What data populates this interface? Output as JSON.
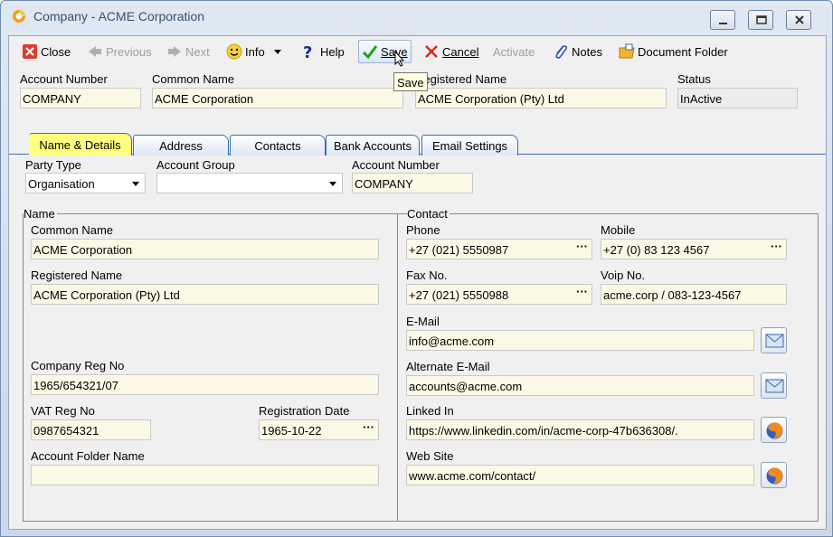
{
  "window": {
    "title": "Company - ACME Corporation"
  },
  "toolbar": {
    "close": "Close",
    "previous": "Previous",
    "next": "Next",
    "info": "Info",
    "help": "Help",
    "save": "Save",
    "cancel": "Cancel",
    "activate": "Activate",
    "notes": "Notes",
    "document_folder": "Document Folder"
  },
  "tooltip": "Save",
  "header": {
    "account_number_label": "Account Number",
    "account_number": "COMPANY",
    "common_name_label": "Common Name",
    "common_name": "ACME Corporation",
    "registered_name_label": "Registered Name",
    "registered_name": "ACME Corporation (Pty) Ltd",
    "status_label": "Status",
    "status": "InActive"
  },
  "tabs": [
    "Name & Details",
    "Address",
    "Contacts",
    "Bank Accounts",
    "Email Settings"
  ],
  "details": {
    "party_type_label": "Party Type",
    "party_type": "Organisation",
    "account_group_label": "Account Group",
    "account_group": "",
    "account_number_label": "Account Number",
    "account_number": "COMPANY"
  },
  "name_group": {
    "title": "Name",
    "common_name_label": "Common Name",
    "common_name": "ACME Corporation",
    "registered_name_label": "Registered Name",
    "registered_name": "ACME Corporation (Pty) Ltd",
    "company_reg_label": "Company Reg No",
    "company_reg": "1965/654321/07",
    "vat_reg_label": "VAT Reg No",
    "vat_reg": "0987654321",
    "reg_date_label": "Registration Date",
    "reg_date": "1965-10-22",
    "folder_label": "Account Folder Name",
    "folder": ""
  },
  "contact_group": {
    "title": "Contact",
    "phone_label": "Phone",
    "phone": "+27 (021) 5550987",
    "mobile_label": "Mobile",
    "mobile": "+27 (0) 83 123 4567",
    "fax_label": "Fax No.",
    "fax": "+27 (021) 5550988",
    "voip_label": "Voip No.",
    "voip": "acme.corp / 083-123-4567",
    "email_label": "E-Mail",
    "email": "info@acme.com",
    "alt_email_label": "Alternate E-Mail",
    "alt_email": "accounts@acme.com",
    "linkedin_label": "Linked In",
    "linkedin": "https://www.linkedin.com/in/acme-corp-47b636308/.",
    "website_label": "Web Site",
    "website": "www.acme.com/contact/"
  },
  "ellipsis": "···",
  "colors": {
    "field_bg": "#fbf9e5",
    "active_tab": "#ffff7f",
    "tab_border": "#3c6fb4"
  }
}
